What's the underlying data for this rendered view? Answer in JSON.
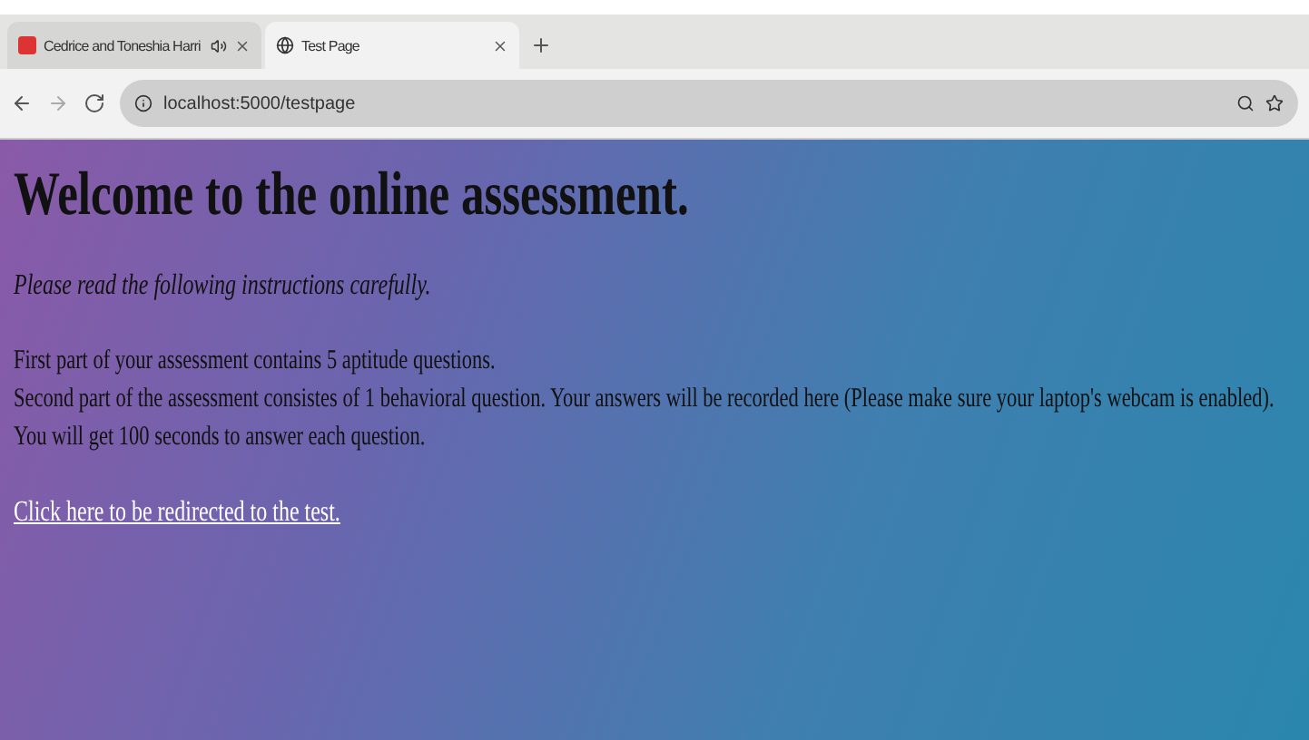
{
  "tabs": [
    {
      "title": "Cedrice and Toneshia Harri",
      "selected": false,
      "audio": true
    },
    {
      "title": "Test Page",
      "selected": true,
      "audio": false
    }
  ],
  "address": "localhost:5000/testpage",
  "heading": "Welcome to the online assessment.",
  "instruction": "Please read the following instructions carefully.",
  "lines": [
    "First part of your assessment contains 5 aptitude questions.",
    "Second part of the assessment consistes of 1 behavioral question. Your answers will be recorded here (Please make sure your laptop's webcam is enabled).",
    "You will get 100 seconds to answer each question."
  ],
  "link": "Click here to be redirected to the test."
}
